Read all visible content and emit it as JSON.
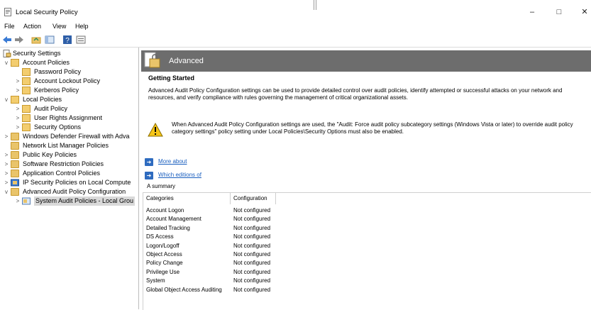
{
  "window": {
    "title": "Local Security Policy"
  },
  "menu": [
    "File",
    "Action",
    "View",
    "Help"
  ],
  "toolbar": [
    "back-icon",
    "forward-icon",
    "up-folder-icon",
    "show-tree-icon",
    "help-icon",
    "properties-icon"
  ],
  "tree": {
    "root": "Security Settings",
    "items": [
      {
        "label": "Account Policies",
        "expander": "v"
      },
      {
        "label": "Password Policy",
        "expander": ""
      },
      {
        "label": "Account Lockout Policy",
        "expander": ">"
      },
      {
        "label": "Kerberos Policy",
        "expander": ">"
      },
      {
        "label": "Local Policies",
        "expander": "v"
      },
      {
        "label": "Audit Policy",
        "expander": ">"
      },
      {
        "label": "User Rights Assignment",
        "expander": ">"
      },
      {
        "label": "Security Options",
        "expander": ">"
      },
      {
        "label": "Windows Defender Firewall with Adva",
        "expander": ">"
      },
      {
        "label": "Network List Manager Policies",
        "expander": ""
      },
      {
        "label": "Public Key Policies",
        "expander": ">"
      },
      {
        "label": "Software Restriction Policies",
        "expander": ">"
      },
      {
        "label": "Application Control Policies",
        "expander": ">"
      },
      {
        "label": "IP Security Policies on Local Compute",
        "expander": ">"
      },
      {
        "label": "Advanced Audit Policy Configuration",
        "expander": "v"
      },
      {
        "label": "System Audit Policies - Local Grou",
        "expander": ">"
      }
    ]
  },
  "main": {
    "banner_title": "Advanced",
    "getting_started_title": "Getting Started",
    "getting_started_text": "Advanced Audit Policy Configuration settings can be used to provide detailed control over audit policies, identify attempted or successful attacks on your network and resources, and verify compliance with rules governing the management of critical organizational assets.",
    "warning_text": "When Advanced Audit Policy Configuration settings are used, the \"Audit: Force audit policy subcategory settings (Windows Vista or later) to override audit policy category settings\" policy setting under Local Policies\\Security Options must also be enabled.",
    "link_more_about": "More about",
    "link_which_editions": "Which editions of",
    "summary_label": "A summary",
    "table": {
      "headers": [
        "Categories",
        "Configuration"
      ],
      "rows": [
        [
          "Account Logon",
          "Not configured"
        ],
        [
          "Account Management",
          "Not configured"
        ],
        [
          "Detailed Tracking",
          "Not configured"
        ],
        [
          "DS Access",
          "Not configured"
        ],
        [
          "Logon/Logoff",
          "Not configured"
        ],
        [
          "Object Access",
          "Not configured"
        ],
        [
          "Policy Change",
          "Not configured"
        ],
        [
          "Privilege Use",
          "Not configured"
        ],
        [
          "System",
          "Not configured"
        ],
        [
          "Global Object Access Auditing",
          "Not configured"
        ]
      ]
    }
  }
}
